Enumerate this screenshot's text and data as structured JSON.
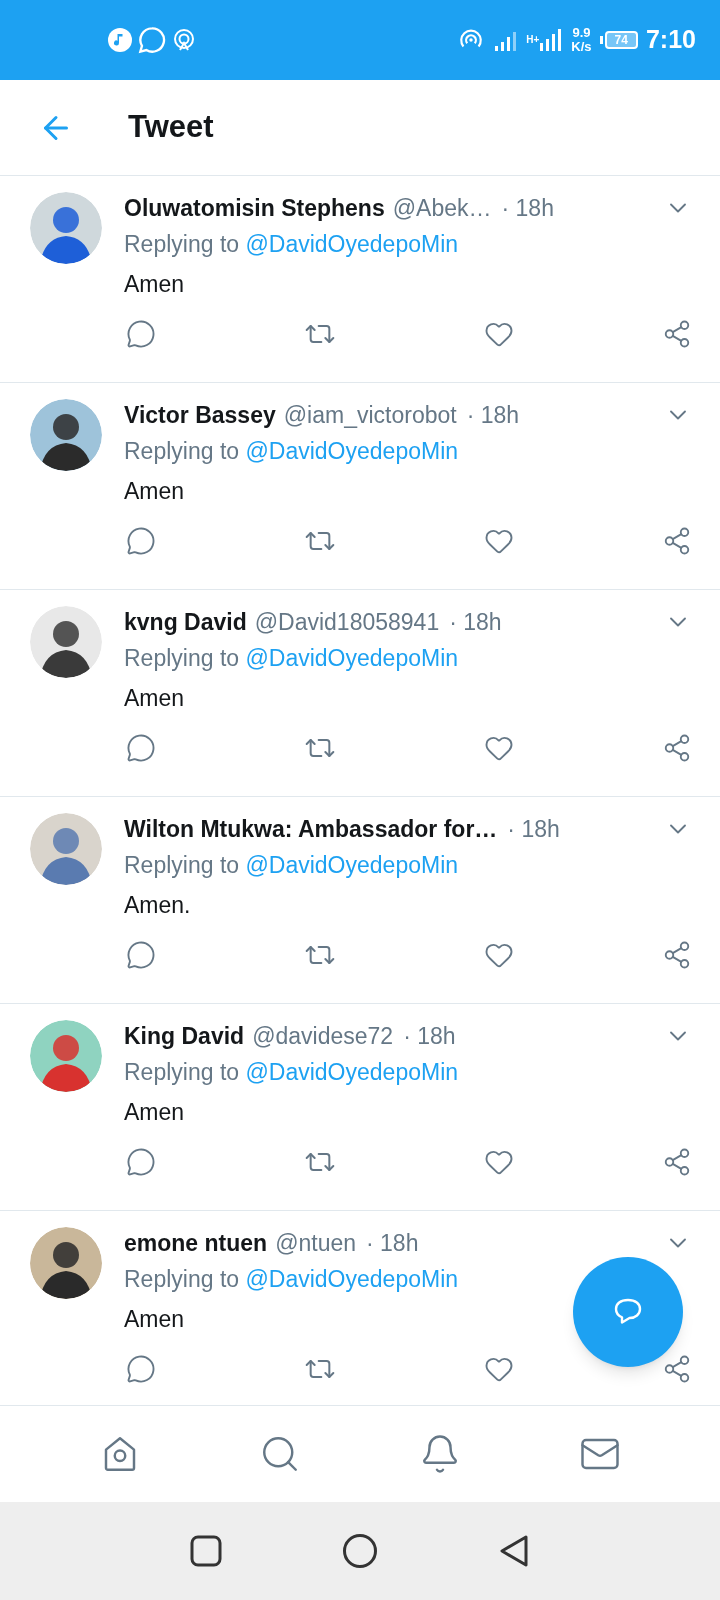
{
  "status_bar": {
    "network_type": "H+",
    "speed_value": "9.9",
    "speed_unit": "K/s",
    "battery": "74",
    "time": "7:10"
  },
  "header": {
    "title": "Tweet"
  },
  "tweets": [
    {
      "name": "Oluwatomisin Stephens",
      "handle": "@Abek…",
      "time": "· 18h",
      "reply_prefix": "Replying to",
      "reply_to": "@DavidOyedepoMin",
      "text": "Amen"
    },
    {
      "name": "Victor Bassey",
      "handle": "@iam_victorobot",
      "time": "· 18h",
      "reply_prefix": "Replying to",
      "reply_to": "@DavidOyedepoMin",
      "text": "Amen"
    },
    {
      "name": "kvng David",
      "handle": "@David18058941",
      "time": "· 18h",
      "reply_prefix": "Replying to",
      "reply_to": "@DavidOyedepoMin",
      "text": "Amen"
    },
    {
      "name": "Wilton Mtukwa: Ambassador for…",
      "time": "· 18h",
      "reply_prefix": "Replying to",
      "reply_to": "@DavidOyedepoMin",
      "text": "Amen."
    },
    {
      "name": "King David",
      "handle": "@davidese72",
      "time": "· 18h",
      "reply_prefix": "Replying to",
      "reply_to": "@DavidOyedepoMin",
      "text": "Amen"
    },
    {
      "name": "emone ntuen",
      "handle": "@ntuen",
      "time": "· 18h",
      "reply_prefix": "Replying to",
      "reply_to": "@DavidOyedepoMin",
      "text": "Amen"
    }
  ]
}
